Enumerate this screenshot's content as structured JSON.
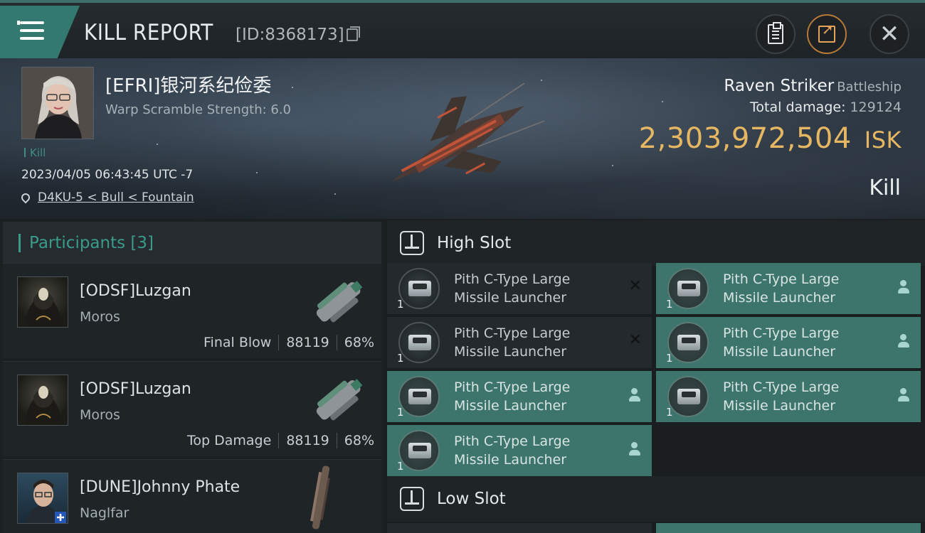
{
  "window": {
    "title": "KILL REPORT",
    "report_id": "[ID:8368173]"
  },
  "victim": {
    "name": "[EFRI]银河系纪俭委",
    "warp_scramble": "Warp Scramble Strength: 6.0",
    "kill_tag": "Kill",
    "datetime": "2023/04/05 06:43:45 UTC -7",
    "location": "D4KU-5 < Bull < Fountain",
    "ship_name": "Raven Striker",
    "ship_class": "Battleship",
    "total_damage_label": "Total damage:",
    "total_damage": "129124",
    "isk_value": "2,303,972,504",
    "isk_unit": "ISK",
    "result": "Kill"
  },
  "participants": {
    "header": "Participants [3]",
    "items": [
      {
        "name": "[ODSF]Luzgan",
        "ship": "Moros",
        "role": "Final Blow",
        "damage": "88119",
        "percent": "68%"
      },
      {
        "name": "[ODSF]Luzgan",
        "ship": "Moros",
        "role": "Top Damage",
        "damage": "88119",
        "percent": "68%"
      },
      {
        "name": "[DUNE]Johnny Phate",
        "ship": "Naglfar",
        "role": "",
        "damage": "",
        "percent": ""
      }
    ]
  },
  "slots": {
    "high_title": "High Slot",
    "low_title": "Low Slot",
    "high_modules": [
      {
        "line1": "Pith C-Type Large",
        "line2": "Missile Launcher",
        "qty": "1",
        "state": "destroyed"
      },
      {
        "line1": "Pith C-Type Large",
        "line2": "Missile Launcher",
        "qty": "1",
        "state": "dropped"
      },
      {
        "line1": "Pith C-Type Large",
        "line2": "Missile Launcher",
        "qty": "1",
        "state": "destroyed"
      },
      {
        "line1": "Pith C-Type Large",
        "line2": "Missile Launcher",
        "qty": "1",
        "state": "dropped"
      },
      {
        "line1": "Pith C-Type Large",
        "line2": "Missile Launcher",
        "qty": "1",
        "state": "dropped"
      },
      {
        "line1": "Pith C-Type Large",
        "line2": "Missile Launcher",
        "qty": "1",
        "state": "dropped"
      },
      {
        "line1": "Pith C-Type Large",
        "line2": "Missile Launcher",
        "qty": "1",
        "state": "dropped"
      }
    ]
  },
  "icons": {
    "menu": "hamburger-menu-icon",
    "copy": "copy-icon",
    "clipboard": "clipboard-icon",
    "share": "share-icon",
    "close": "close-icon",
    "location": "map-pin-icon",
    "slot": "slot-icon",
    "destroyed": "x-icon",
    "dropped": "person-icon"
  },
  "colors": {
    "accent": "#3b9b8b",
    "isk": "#e5b763",
    "dropped_bg": "#3d756d"
  }
}
